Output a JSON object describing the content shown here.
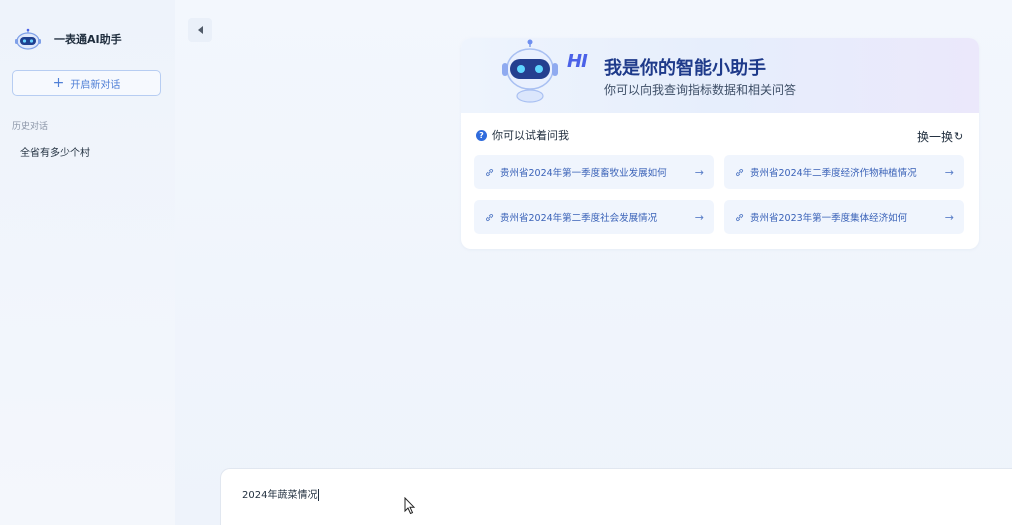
{
  "sidebar": {
    "brand_title": "一表通AI助手",
    "new_chat_label": "开启新对话",
    "history_heading": "历史对话",
    "history_items": [
      "全省有多少个村"
    ]
  },
  "welcome": {
    "hi_text": "HI",
    "title": "我是你的智能小助手",
    "subtitle": "你可以向我查询指标数据和相关问答",
    "suggest_label": "你可以试着问我",
    "refresh_label": "换一换",
    "suggestions": [
      "贵州省2024年第一季度畜牧业发展如何",
      "贵州省2024年二季度经济作物种植情况",
      "贵州省2024年第二季度社会发展情况",
      "贵州省2023年第一季度集体经济如何"
    ]
  },
  "input": {
    "value": "2024年蔬菜情况"
  },
  "colors": {
    "accent": "#2f6bdc",
    "title_blue": "#1e3a8a",
    "suggestion_bg": "#f0f5fd",
    "suggestion_text": "#3a62b8"
  }
}
